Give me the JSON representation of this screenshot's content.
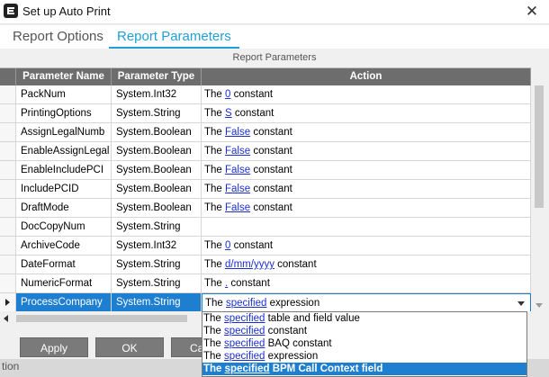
{
  "window": {
    "title": "Set up Auto Print",
    "close_glyph": "✕",
    "app_icon": "app-logo-icon"
  },
  "tabs": [
    {
      "label": "Report Options"
    },
    {
      "label": "Report Parameters",
      "active": true
    }
  ],
  "grid": {
    "caption": "Report Parameters",
    "columns": {
      "name": "Parameter Name",
      "type": "Parameter Type",
      "action": "Action"
    },
    "rows": [
      {
        "name": "PackNum",
        "type": "System.Int32",
        "pre": "The ",
        "link": "0",
        "post": " constant"
      },
      {
        "name": "PrintingOptions",
        "type": "System.String",
        "pre": "The ",
        "link": "S",
        "post": " constant"
      },
      {
        "name": "AssignLegalNumb",
        "type": "System.Boolean",
        "pre": "The ",
        "link": "False",
        "post": " constant"
      },
      {
        "name": "EnableAssignLegal",
        "type": "System.Boolean",
        "pre": "The ",
        "link": "False",
        "post": " constant"
      },
      {
        "name": "EnableIncludePCI",
        "type": "System.Boolean",
        "pre": "The ",
        "link": "False",
        "post": " constant"
      },
      {
        "name": "IncludePCID",
        "type": "System.Boolean",
        "pre": "The ",
        "link": "False",
        "post": " constant"
      },
      {
        "name": "DraftMode",
        "type": "System.Boolean",
        "pre": "The ",
        "link": "False",
        "post": " constant"
      },
      {
        "name": "DocCopyNum",
        "type": "System.String",
        "pre": "",
        "link": "",
        "post": ""
      },
      {
        "name": "ArchiveCode",
        "type": "System.Int32",
        "pre": "The ",
        "link": "0",
        "post": " constant"
      },
      {
        "name": "DateFormat",
        "type": "System.String",
        "pre": "The ",
        "link": "d/mm/yyyy",
        "post": " constant"
      },
      {
        "name": "NumericFormat",
        "type": "System.String",
        "pre": "The ",
        "link": ".",
        "post": " constant"
      },
      {
        "name": "ProcessCompany",
        "type": "System.String",
        "pre": "The ",
        "link": "specified",
        "post": " expression",
        "selected": true
      }
    ]
  },
  "dropdown": {
    "options": [
      {
        "pre": "The ",
        "link": "specified",
        "post": " table and field value"
      },
      {
        "pre": "The ",
        "link": "specified",
        "post": " constant"
      },
      {
        "pre": "The ",
        "link": "specified",
        "post": " BAQ constant"
      },
      {
        "pre": "The ",
        "link": "specified",
        "post": " expression"
      },
      {
        "pre": "The ",
        "link": "specified",
        "post": " BPM Call Context field",
        "highlight": true
      }
    ]
  },
  "buttons": {
    "apply": "Apply",
    "ok": "OK",
    "cancel": "Ca"
  },
  "status": {
    "text": "tion"
  },
  "colors": {
    "accent": "#1fa0d8",
    "selection": "#1e7fd0",
    "link": "#1b2fd1",
    "header": "#6d6d6d"
  }
}
